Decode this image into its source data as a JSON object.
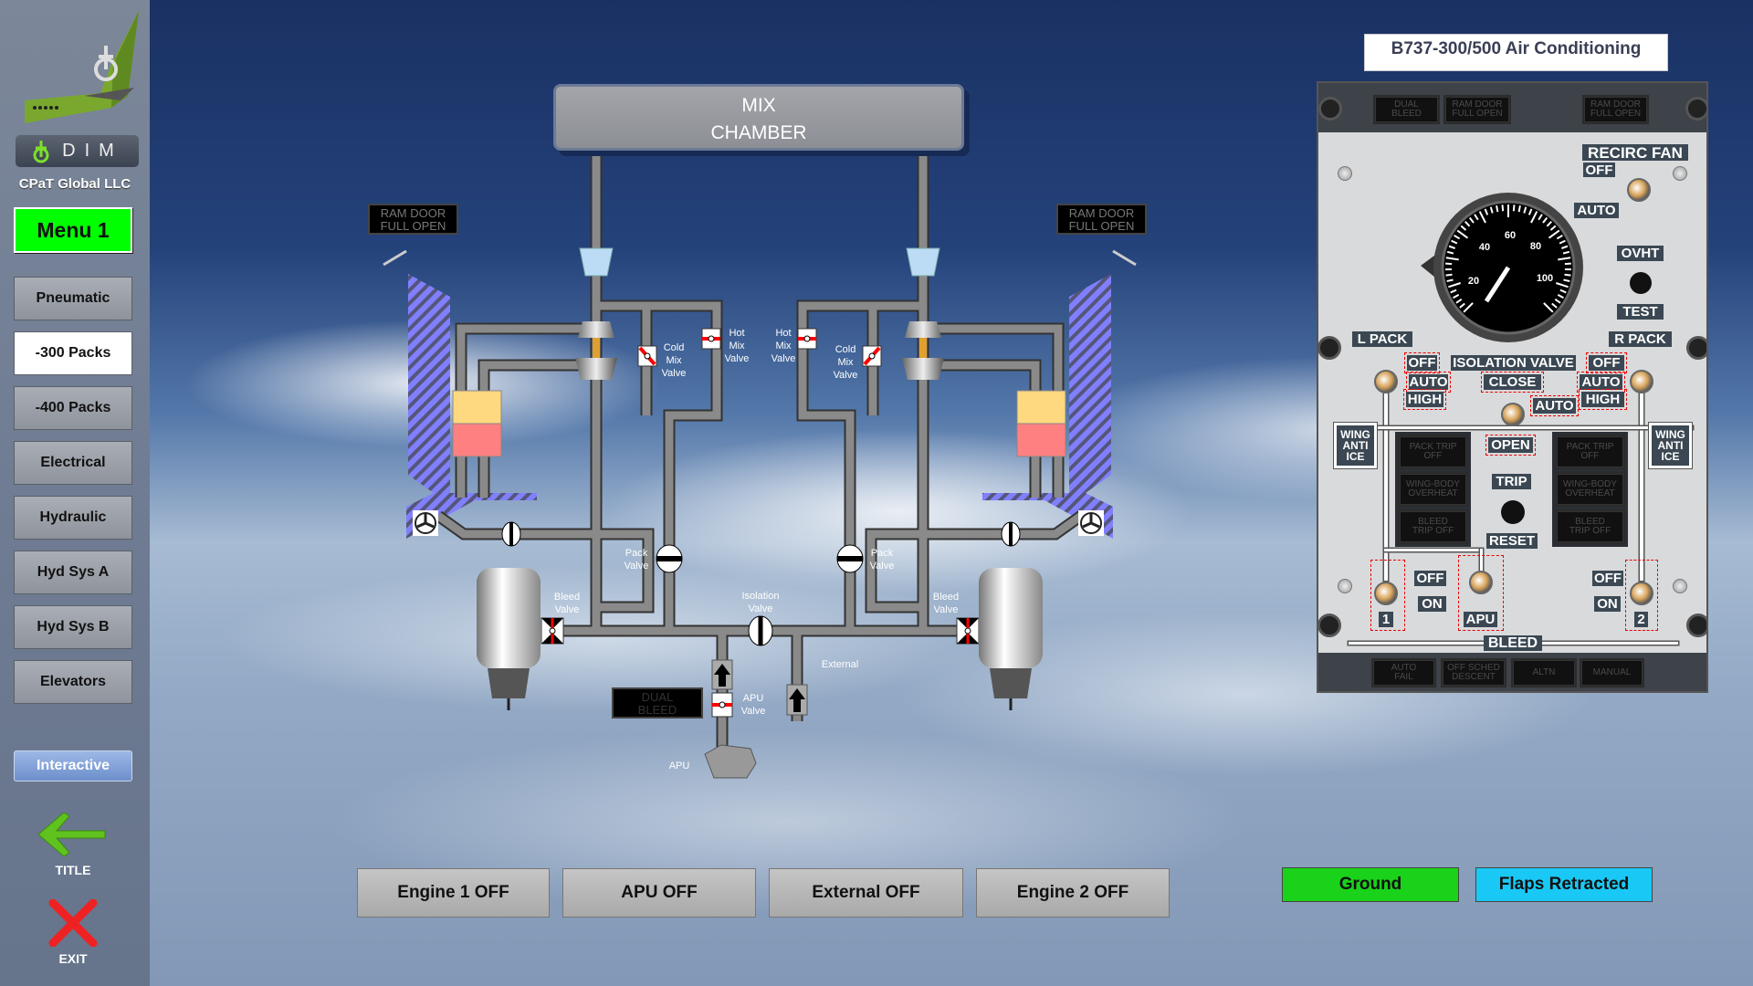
{
  "sidebar": {
    "company": "CPaT Global LLC",
    "logo_text": "DIM",
    "menu_label": "Menu 1",
    "items": [
      {
        "label": "Pneumatic",
        "selected": false
      },
      {
        "label": "-300 Packs",
        "selected": true
      },
      {
        "label": "-400 Packs",
        "selected": false
      },
      {
        "label": "Electrical",
        "selected": false
      },
      {
        "label": "Hydraulic",
        "selected": false
      },
      {
        "label": "Hyd Sys A",
        "selected": false
      },
      {
        "label": "Hyd Sys B",
        "selected": false
      },
      {
        "label": "Elevators",
        "selected": false
      }
    ],
    "interactive_label": "Interactive",
    "title_label": "TITLE",
    "exit_label": "EXIT"
  },
  "colors": {
    "menu_green": "#00ff00",
    "ground_green": "#19d219",
    "flaps_cyan": "#19c8f5",
    "interactive_blue": "#7e9fd6",
    "ram_duct": "#8080ff",
    "heat_exchanger_top": "#ffd980",
    "heat_exchanger_bottom": "#ff8080",
    "valve_red": "#ff0000"
  },
  "diagram": {
    "mix_chamber": [
      "MIX",
      "CHAMBER"
    ],
    "ram_door_left": [
      "RAM DOOR",
      "FULL OPEN"
    ],
    "ram_door_right": [
      "RAM DOOR",
      "FULL OPEN"
    ],
    "cold_mix_valve_left": [
      "Cold",
      "Mix",
      "Valve"
    ],
    "hot_mix_valve_left": [
      "Hot",
      "Mix",
      "Valve"
    ],
    "hot_mix_valve_right": [
      "Hot",
      "Mix",
      "Valve"
    ],
    "cold_mix_valve_right": [
      "Cold",
      "Mix",
      "Valve"
    ],
    "pack_valve_left": [
      "Pack",
      "Valve"
    ],
    "pack_valve_right": [
      "Pack",
      "Valve"
    ],
    "bleed_valve_left": [
      "Bleed",
      "Valve"
    ],
    "bleed_valve_right": [
      "Bleed",
      "Valve"
    ],
    "isolation_valve": [
      "Isolation",
      "Valve"
    ],
    "external": "External",
    "apu_valve": [
      "APU",
      "Valve"
    ],
    "dual_bleed": [
      "DUAL",
      "BLEED"
    ],
    "apu": "APU"
  },
  "controls": {
    "engine1": "Engine 1 OFF",
    "apu": "APU OFF",
    "external": "External OFF",
    "engine2": "Engine 2 OFF",
    "ground": "Ground",
    "flaps": "Flaps Retracted"
  },
  "panel": {
    "title": "B737-300/500 Air Conditioning",
    "top_annunciators": [
      [
        "DUAL",
        "BLEED"
      ],
      [
        "RAM DOOR",
        "FULL OPEN"
      ],
      [
        "RAM DOOR",
        "FULL OPEN"
      ]
    ],
    "recirc_fan": "RECIRC FAN",
    "recirc_off": "OFF",
    "recirc_auto": "AUTO",
    "gauge_ticks": [
      "20",
      "40",
      "60",
      "80",
      "100"
    ],
    "ovht": "OVHT",
    "test": "TEST",
    "l_pack": "L PACK",
    "r_pack": "R PACK",
    "l_off": "OFF",
    "l_auto": "AUTO",
    "l_high": "HIGH",
    "r_off": "OFF",
    "r_auto": "AUTO",
    "r_high": "HIGH",
    "isolation_valve": "ISOLATION VALVE",
    "iso_close": "CLOSE",
    "iso_auto": "AUTO",
    "iso_open": "OPEN",
    "wing_anti_ice": [
      "WING",
      "ANTI",
      "ICE"
    ],
    "left_annunciators": [
      [
        "PACK TRIP",
        "OFF"
      ],
      [
        "WING-BODY",
        "OVERHEAT"
      ],
      [
        "BLEED",
        "TRIP OFF"
      ]
    ],
    "right_annunciators": [
      [
        "PACK TRIP",
        "OFF"
      ],
      [
        "WING-BODY",
        "OVERHEAT"
      ],
      [
        "BLEED",
        "TRIP OFF"
      ]
    ],
    "trip": "TRIP",
    "reset": "RESET",
    "bleed_off": "OFF",
    "bleed_on": "ON",
    "bleed1": "1",
    "bleed_apu": "APU",
    "bleed2": "2",
    "bleed": "BLEED",
    "bottom_annunciators": [
      [
        "AUTO",
        "FAIL"
      ],
      [
        "OFF SCHED",
        "DESCENT"
      ],
      [
        "ALTN",
        ""
      ],
      [
        "MANUAL",
        ""
      ]
    ]
  }
}
